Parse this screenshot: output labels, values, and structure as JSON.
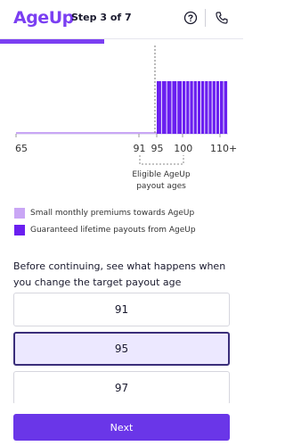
{
  "header": {
    "logo": "AgeUp",
    "step": "Step 3 of 7",
    "help_icon": "help-circle-icon",
    "phone_icon": "phone-icon"
  },
  "progress": {
    "fraction": 0.43
  },
  "colors": {
    "brand": "#7b3ff2",
    "premium": "#c9a6f5",
    "payout": "#6a1ff0",
    "next_button": "#6a36e8"
  },
  "chart_data": {
    "type": "bar",
    "x_ticks": [
      "65",
      "91",
      "95",
      "100",
      "110+"
    ],
    "x_range": [
      65,
      112
    ],
    "payout_start_age": 95,
    "series": [
      {
        "name": "Small monthly premiums towards AgeUp",
        "from_age": 65,
        "to_age": 95,
        "level": 0
      },
      {
        "name": "Guaranteed lifetime payouts from AgeUp",
        "from_age": 95,
        "to_age": 112,
        "level": 1
      }
    ],
    "annotation": "Eligible AgeUp payout ages",
    "eligible_range": [
      91,
      100
    ]
  },
  "legend": [
    {
      "label": "Small monthly premiums towards AgeUp"
    },
    {
      "label": "Guaranteed lifetime payouts from AgeUp"
    }
  ],
  "prompt": "Before continuing, see what happens when you change the target payout age",
  "options": [
    {
      "label": "91",
      "selected": false
    },
    {
      "label": "95",
      "selected": true
    },
    {
      "label": "97",
      "selected": false
    }
  ],
  "next_label": "Next"
}
